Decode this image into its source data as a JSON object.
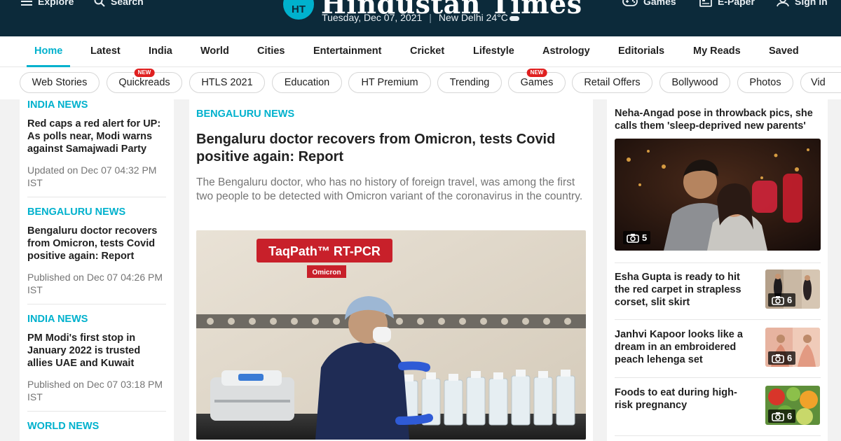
{
  "topbar": {
    "explore": "Explore",
    "search": "Search",
    "logo_badge": "HT",
    "logo_text": "Hindustan Times",
    "date": "Tuesday, Dec 07, 2021",
    "location": "New Delhi",
    "temp": "24",
    "temp_unit": "°C",
    "games": "Games",
    "epaper": "E-Paper",
    "signin": "Sign in"
  },
  "nav": {
    "items": [
      "Home",
      "Latest",
      "India",
      "World",
      "Cities",
      "Entertainment",
      "Cricket",
      "Lifestyle",
      "Astrology",
      "Editorials",
      "My Reads",
      "Saved"
    ],
    "active": "Home"
  },
  "chips": {
    "items": [
      "Web Stories",
      "Quickreads",
      "HTLS 2021",
      "Education",
      "HT Premium",
      "Trending",
      "Games",
      "Retail Offers",
      "Bollywood",
      "Photos",
      "Vid"
    ],
    "new_badge": "NEW"
  },
  "left_stories": [
    {
      "section": "INDIA NEWS",
      "headline": "Red caps a red alert for UP: As polls near, Modi warns against Samajwadi Party",
      "time": "Updated on Dec 07 04:32 PM IST"
    },
    {
      "section": "BENGALURU NEWS",
      "headline": "Bengaluru doctor recovers from Omicron, tests Covid positive again: Report",
      "time": "Published on Dec 07 04:26 PM IST"
    },
    {
      "section": "INDIA NEWS",
      "headline": "PM Modi's first stop in January 2022 is trusted allies UAE and Kuwait",
      "time": "Published on Dec 07 03:18 PM IST"
    },
    {
      "section": "WORLD NEWS",
      "headline": "",
      "time": ""
    }
  ],
  "main_story": {
    "section": "BENGALURU NEWS",
    "headline": "Bengaluru doctor recovers from Omicron, tests Covid positive again: Report",
    "summary": "The Bengaluru doctor, who has no history of foreign travel, was among the first two people to be detected with Omicron variant of the coronavirus in the country.",
    "image_sign": "TaqPath™ RT-PCR",
    "image_tag": "Omicron"
  },
  "right_top": {
    "headline": "Neha-Angad pose in throwback pics, she calls them 'sleep-deprived new parents'",
    "photo_count": "5"
  },
  "right_stories": [
    {
      "headline": "Esha Gupta is ready to hit the red carpet in strapless corset, slit skirt",
      "photo_count": "6"
    },
    {
      "headline": "Janhvi Kapoor looks like a dream in an embroidered peach lehenga set",
      "photo_count": "6"
    },
    {
      "headline": "Foods to eat during high-risk pregnancy",
      "photo_count": "6"
    }
  ],
  "colors": {
    "accent": "#00b1cd",
    "topbar_bg": "#0c2a3a",
    "new_badge": "#e02020"
  }
}
